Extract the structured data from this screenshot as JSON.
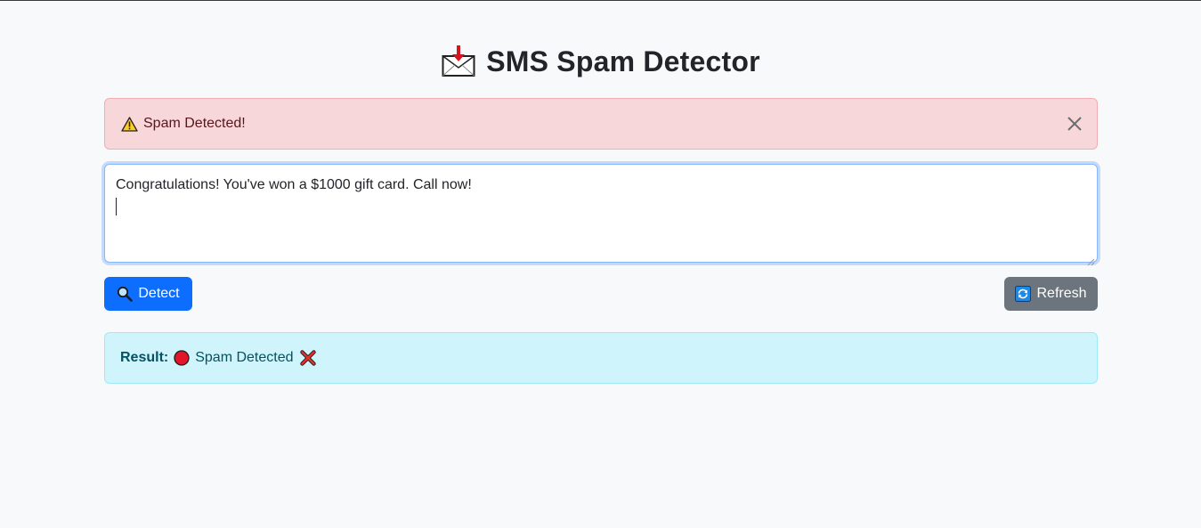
{
  "header": {
    "title": "SMS Spam Detector",
    "icon": "envelope-download-icon"
  },
  "alert": {
    "message": "Spam Detected!",
    "icon": "warning-icon",
    "close_icon": "close-icon"
  },
  "message_input": {
    "value": "Congratulations! You've won a $1000 gift card. Call now!"
  },
  "buttons": {
    "detect_label": "Detect",
    "detect_icon": "magnifier-icon",
    "refresh_label": "Refresh",
    "refresh_icon": "refresh-icon"
  },
  "result": {
    "label": "Result:",
    "text": "Spam Detected",
    "status_icon": "red-circle-icon",
    "mark_icon": "cross-mark-icon"
  },
  "colors": {
    "primary": "#0d6efd",
    "secondary": "#6c757d",
    "danger_bg": "#f8d7da",
    "info_bg": "#cff4fc"
  }
}
